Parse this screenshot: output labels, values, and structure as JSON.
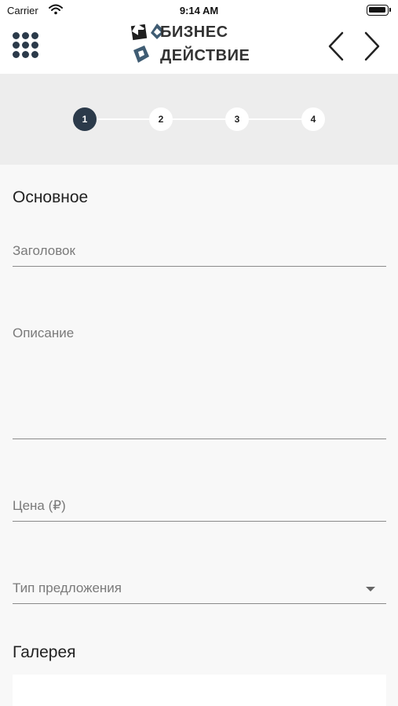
{
  "status_bar": {
    "carrier": "Carrier",
    "time": "9:14 AM",
    "battery_level": 1.0
  },
  "header": {
    "logo_line1": "БИЗНЕС",
    "logo_line2": "ДЕЙСТВИЕ",
    "icons": {
      "menu": "grid-menu-icon",
      "prev": "chevron-left-icon",
      "next": "chevron-right-icon"
    }
  },
  "stepper": {
    "steps": [
      "1",
      "2",
      "3",
      "4"
    ],
    "active_step": 1,
    "active_color": "#2b3a4a"
  },
  "form": {
    "main_section_title": "Основное",
    "title_label": "Заголовок",
    "description_label": "Описание",
    "price_label": "Цена (₽)",
    "offer_type_label": "Тип предложения",
    "gallery_section_title": "Галерея"
  }
}
